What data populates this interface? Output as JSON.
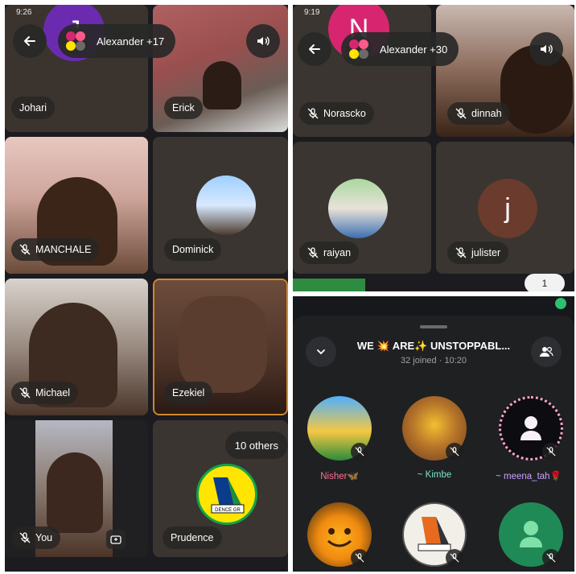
{
  "panel_a": {
    "status_time": "9:26",
    "group_label": "Alexander +17",
    "tiles": [
      {
        "name": "Johari",
        "avatar_letter": "J"
      },
      {
        "name": "Erick"
      },
      {
        "name": "MANCHALE"
      },
      {
        "name": "Dominick"
      },
      {
        "name": "Michael"
      },
      {
        "name": "Ezekiel"
      },
      {
        "name": "You"
      },
      {
        "name": "Prudence",
        "others": "10 others"
      }
    ],
    "logo_text": "DENCE GR"
  },
  "panel_b": {
    "status_time": "9:19",
    "group_label": "Alexander +30",
    "tiles": [
      {
        "name": "Norascko",
        "avatar_letter": "N"
      },
      {
        "name": "dinnah"
      },
      {
        "name": "raiyan"
      },
      {
        "name": "julister",
        "avatar_letter": "j"
      }
    ],
    "counter": "1"
  },
  "panel_c": {
    "title": "WE 💥 ARE✨ UNSTOPPABL...",
    "subtitle": "32 joined · 10:20",
    "participants": [
      {
        "name": "Nisher🦋",
        "color": "#ff6f91"
      },
      {
        "name": "~ Kimbe",
        "color": "#7fe3c8"
      },
      {
        "name": "~ meena_tah🌹",
        "color": "#c7a3ff"
      },
      {
        "name": ""
      },
      {
        "name": ""
      },
      {
        "name": ""
      }
    ]
  },
  "colors": {
    "mic_green": "#2fbf71",
    "tile_bg": "#3a3530",
    "pink_avatar": "#d7266f",
    "purple_avatar": "#6a2bb0",
    "brown_avatar": "#6b3b2d"
  }
}
